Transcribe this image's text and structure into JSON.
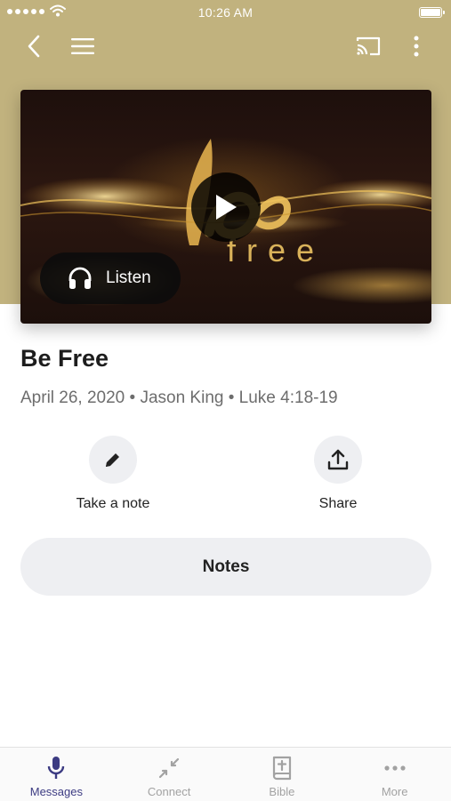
{
  "status_bar": {
    "time": "10:26 AM"
  },
  "nav": {
    "icons": [
      "chevron-left-icon",
      "hamburger-menu-icon",
      "cast-icon",
      "more-vertical-icon"
    ]
  },
  "video": {
    "overlay_text": "free",
    "listen_label": "Listen"
  },
  "message": {
    "title": "Be Free",
    "meta": "April 26, 2020 • Jason King • Luke 4:18-19"
  },
  "actions": {
    "take_note_label": "Take a note",
    "share_label": "Share"
  },
  "notes_button_label": "Notes",
  "tabs": [
    {
      "label": "Messages",
      "icon": "microphone-icon",
      "active": true
    },
    {
      "label": "Connect",
      "icon": "arrows-in-icon",
      "active": false
    },
    {
      "label": "Bible",
      "icon": "bible-icon",
      "active": false
    },
    {
      "label": "More",
      "icon": "more-horizontal-icon",
      "active": false
    }
  ],
  "colors": {
    "hero_background": "#c1b27e",
    "active_tab": "#3c3b82",
    "inactive_tab": "#a2a2a2",
    "pill_background": "#eeeff2"
  }
}
